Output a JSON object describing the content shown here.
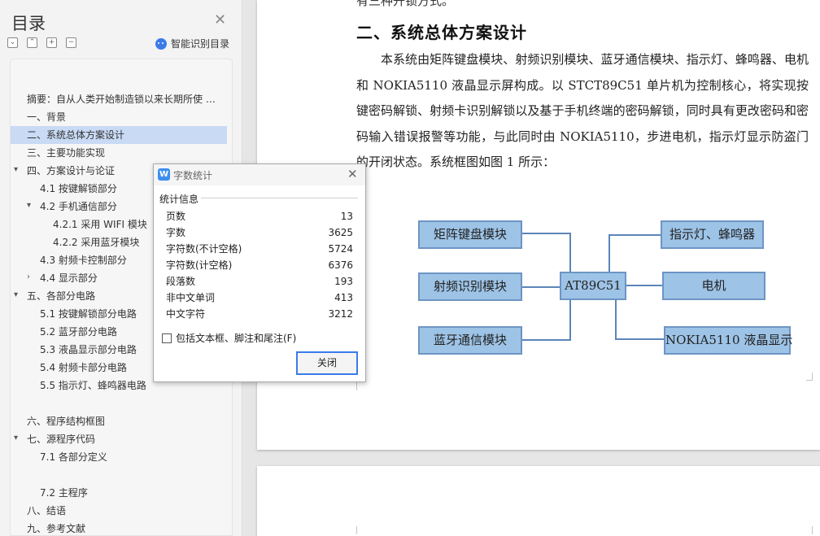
{
  "toc": {
    "title": "目录",
    "smart_label": "智能识别目录",
    "items": [
      {
        "label": "摘要：自从人类开始制造锁以来长期所使 …",
        "bold": true
      },
      {
        "label": "一、背景"
      },
      {
        "label": "二、系统总体方案设计",
        "selected": true
      },
      {
        "label": "三、主要功能实现"
      },
      {
        "label": "四、方案设计与论证"
      },
      {
        "label": "4.1 按键解锁部分"
      },
      {
        "label": "4.2 手机通信部分"
      },
      {
        "label": "4.2.1  采用 WIFI 模块"
      },
      {
        "label": "4.2.2  采用蓝牙模块"
      },
      {
        "label": "4.3 射频卡控制部分"
      },
      {
        "label": "4.4 显示部分"
      },
      {
        "label": "五、各部分电路"
      },
      {
        "label": "5.1 按键解锁部分电路"
      },
      {
        "label": "5.2 蓝牙部分电路"
      },
      {
        "label": "5.3 液晶显示部分电路"
      },
      {
        "label": "5.4 射频卡部分电路"
      },
      {
        "label": "5.5 指示灯、蜂鸣器电路"
      },
      {
        "label": "六、程序结构框图"
      },
      {
        "label": "七、源程序代码"
      },
      {
        "label": "7.1 各部分定义"
      },
      {
        "label": "7.2 主程序"
      },
      {
        "label": "八、结语"
      },
      {
        "label": "九、参考文献"
      }
    ]
  },
  "document": {
    "top_cut_text": "有三种开锁方式。",
    "heading": "二、系统总体方案设计",
    "paragraph": "本系统由矩阵键盘模块、射频识别模块、蓝牙通信模块、指示灯、蜂鸣器、电机和 NOKIA5110 液晶显示屏构成。以 STCT89C51 单片机为控制核心，将实现按键密码解锁、射频卡识别解锁以及基于手机终端的密码解锁，同时具有更改密码和密码输入错误报警等功能，与此同时由 NOKIA5110，步进电机，指示灯显示防盗门的开闭状态。系统框图如图 1 所示："
  },
  "diagram": {
    "left_modules": [
      "矩阵键盘模块",
      "射频识别模块",
      "蓝牙通信模块"
    ],
    "controller": "AT89C51",
    "right_modules": [
      "指示灯、蜂鸣器",
      "电机",
      "NOKIA5110 液晶显示"
    ]
  },
  "word_count": {
    "title": "字数统计",
    "section": "统计信息",
    "rows": [
      {
        "label": "页数",
        "value": "13"
      },
      {
        "label": "字数",
        "value": "3625"
      },
      {
        "label": "字符数(不计空格)",
        "value": "5724"
      },
      {
        "label": "字符数(计空格)",
        "value": "6376"
      },
      {
        "label": "段落数",
        "value": "193"
      },
      {
        "label": "非中文单词",
        "value": "413"
      },
      {
        "label": "中文字符",
        "value": "3212"
      }
    ],
    "include_label": "包括文本框、脚注和尾注(F)",
    "close_label": "关闭"
  },
  "colors": {
    "selection": "#c9daf5",
    "diagram_fill": "#9dc3e6",
    "diagram_line": "#5b86b8",
    "accent": "#3b7be8"
  }
}
